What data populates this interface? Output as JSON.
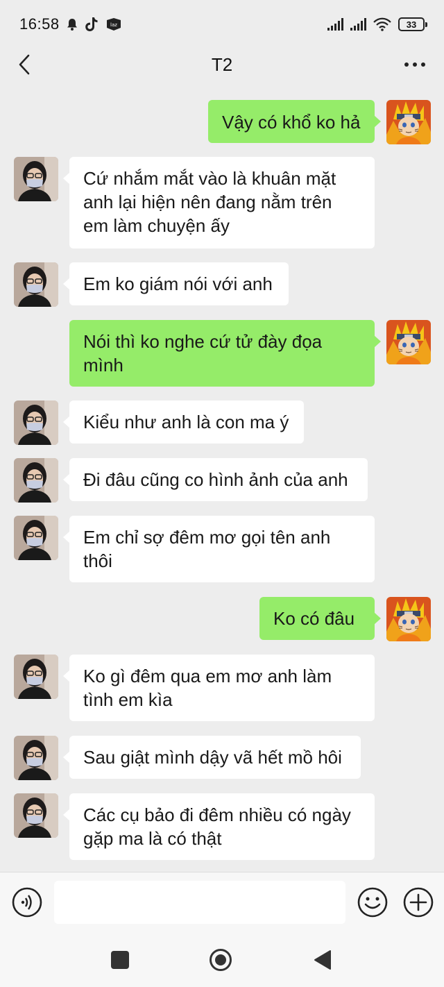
{
  "status_bar": {
    "time": "16:58",
    "battery": "33",
    "icons": [
      "bell-icon",
      "tiktok-icon",
      "lazada-icon",
      "signal-icon",
      "signal-icon",
      "wifi-icon",
      "battery-icon"
    ]
  },
  "header": {
    "title": "T2",
    "back_icon": "chevron-left-icon",
    "more_icon": "more-horizontal-icon"
  },
  "messages": [
    {
      "side": "out",
      "text": "Vậy có khổ ko hả"
    },
    {
      "side": "in",
      "text": "Cứ nhắm mắt vào là khuân mặt anh lại hiện nên đang nằm trên em làm chuyện ấy"
    },
    {
      "side": "in",
      "text": "Em ko giám nói với anh"
    },
    {
      "side": "out",
      "text": "Nói thì ko nghe cứ tử đày đọa mình"
    },
    {
      "side": "in",
      "text": "Kiểu như anh là con ma ý"
    },
    {
      "side": "in",
      "text": "Đi đâu cũng co hình ảnh của anh"
    },
    {
      "side": "in",
      "text": "Em chỉ sợ đêm mơ gọi tên anh thôi"
    },
    {
      "side": "out",
      "text": "Ko có đâu"
    },
    {
      "side": "in",
      "text": "Ko gì đêm qua em mơ anh làm tình em kìa"
    },
    {
      "side": "in",
      "text": "Sau giật mình dậy vã hết mồ hôi"
    },
    {
      "side": "in",
      "text": "Các cụ bảo đi đêm nhiều có ngày gặp ma là có thật"
    }
  ],
  "input_bar": {
    "value": "",
    "icons": [
      "voice-icon",
      "emoji-icon",
      "plus-icon"
    ]
  },
  "nav_bar": {
    "icons": [
      "recents-icon",
      "home-icon",
      "back-triangle-icon"
    ]
  },
  "colors": {
    "background": "#ededed",
    "outgoing_bubble": "#95ec69",
    "incoming_bubble": "#ffffff"
  }
}
